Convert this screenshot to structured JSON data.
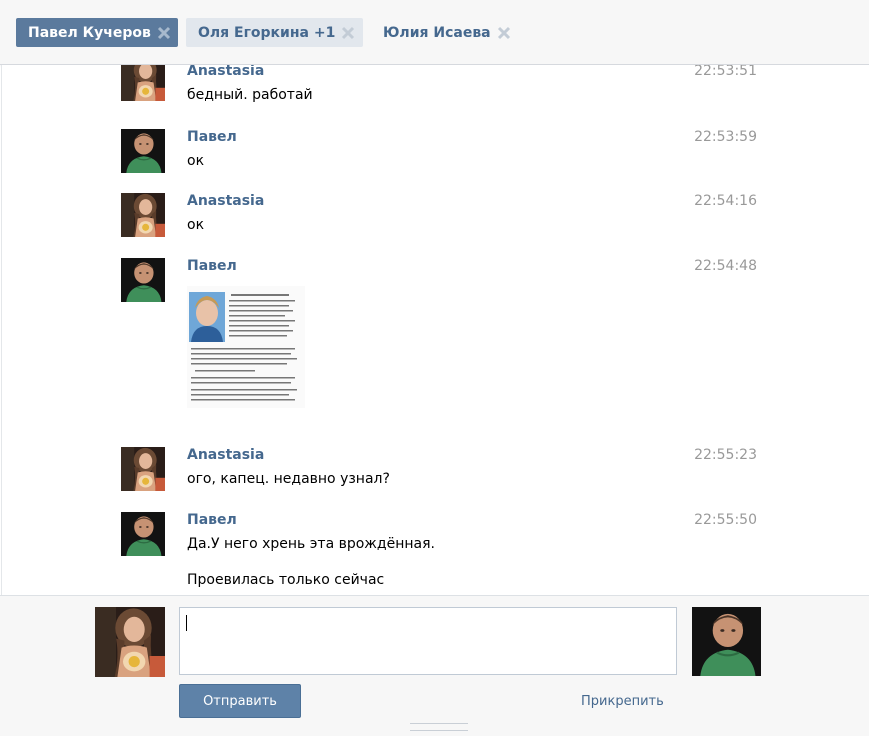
{
  "tabs": [
    {
      "label": "Павел Кучеров",
      "state": "active"
    },
    {
      "label": "Оля Егоркина +1",
      "state": "muted"
    },
    {
      "label": "Юлия Исаева",
      "state": "plain"
    }
  ],
  "messages": [
    {
      "author": "Anastasia",
      "time": "22:53:51",
      "text": "бедный. работай"
    },
    {
      "author": "Павел",
      "time": "22:53:59",
      "text": "ок"
    },
    {
      "author": "Anastasia",
      "time": "22:54:16",
      "text": "ок"
    },
    {
      "author": "Павел",
      "time": "22:54:48",
      "attachment": "photo"
    },
    {
      "author": "Anastasia",
      "time": "22:55:23",
      "text": "ого, капец. недавно узнал?"
    },
    {
      "author": "Павел",
      "time": "22:55:50",
      "text": "Да.У него хрень эта врождённая.",
      "text2": "Проевилась только сейчас"
    }
  ],
  "compose": {
    "input_value": "",
    "send_label": "Отправить",
    "attach_label": "Прикрепить"
  },
  "colors": {
    "accent": "#5b7a9d",
    "link": "#45688e",
    "time": "#999999"
  },
  "icons": {
    "tab_close": "close-icon"
  }
}
